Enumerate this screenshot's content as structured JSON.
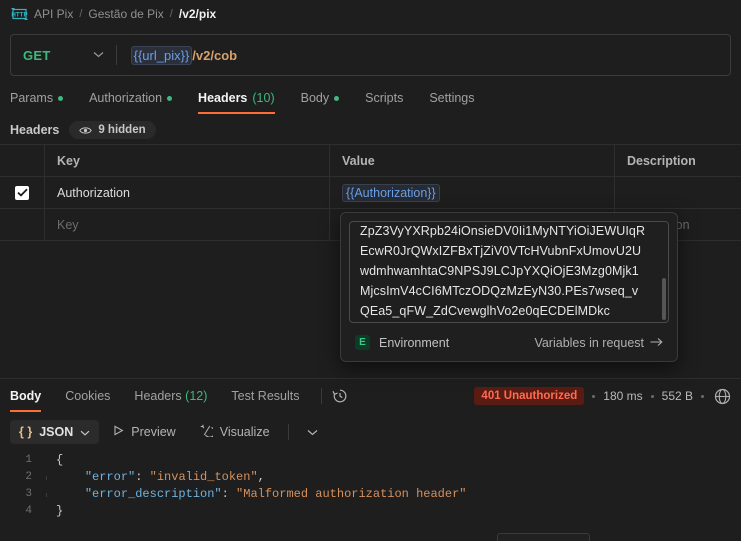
{
  "breadcrumb": {
    "icon": "http-protocol-icon",
    "items": [
      "API Pix",
      "Gestão de Pix"
    ],
    "separator": "/",
    "current": "/v2/pix"
  },
  "url_bar": {
    "method": "GET",
    "method_chevron": "chevron-down-icon",
    "url_variable": "{{url_pix}}",
    "url_path": "/v2/cob"
  },
  "request_tabs": [
    {
      "label": "Params",
      "dot": true,
      "count": "",
      "active": false
    },
    {
      "label": "Authorization",
      "dot": true,
      "count": "",
      "active": false
    },
    {
      "label": "Headers",
      "dot": false,
      "count": "(10)",
      "active": true
    },
    {
      "label": "Body",
      "dot": true,
      "count": "",
      "active": false
    },
    {
      "label": "Scripts",
      "dot": false,
      "count": "",
      "active": false
    },
    {
      "label": "Settings",
      "dot": false,
      "count": "",
      "active": false
    }
  ],
  "headers_section": {
    "title": "Headers",
    "hidden_badge": "9 hidden",
    "hidden_icon": "eye-icon",
    "columns": [
      "Key",
      "Value",
      "Description"
    ],
    "rows": [
      {
        "checked": true,
        "key": "Authorization",
        "value": "{{Authorization}}",
        "value_is_variable": true,
        "description": ""
      },
      {
        "checked": false,
        "key_placeholder": "Key",
        "value_placeholder": "Value",
        "description_placeholder": "Description"
      }
    ]
  },
  "variable_popup": {
    "token_value": "ZpZ3VyYXRpb24iOnsieDV0IjoiMyNTYiOiJEWUIqR EcwR0JrQWxIZFBxTjZiV0VTcHVubnFUUmovU2U wdmhwamhtaC9NPSJ9LCJpYXQiOjE3Mzg0Mjk1Mjcs ImV4cCI6MTczODQzMzEyN30.PEs7wseq_v QEa5_qFW_ZdCvewglhVo2e0qECDElMDkc",
    "token_lines": [
      "ZpZ3VyYXRpb24iOnsieDV0Ii1MyNTYiOiJEWUIqR",
      "EcwR0JrQWxIZFBxTjZiV0VTcHVubnFxUmovU2U",
      "wdmhwamhtaC9NPSJ9LCJpYXQiOjE3Mzg0Mjk1",
      "MjcsImV4cCI6MTczODQzMzEyN30.PEs7wseq_v",
      "QEa5_qFW_ZdCvewglhVo2e0qECDElMDkc"
    ],
    "environment_badge": "E",
    "environment_label": "Environment",
    "variables_link": "Variables in request",
    "variables_link_icon": "arrow-right-icon"
  },
  "response": {
    "tabs": [
      {
        "label": "Body",
        "count": "",
        "active": true
      },
      {
        "label": "Cookies",
        "count": "",
        "active": false
      },
      {
        "label": "Headers",
        "count": "(12)",
        "active": false
      },
      {
        "label": "Test Results",
        "count": "",
        "active": false
      }
    ],
    "history_icon": "clock-history-icon",
    "status": "401 Unauthorized",
    "time": "180 ms",
    "size": "552 B",
    "globe_icon": "globe-icon",
    "status_color": "#ff6b52",
    "status_bg": "#5a1c12"
  },
  "body_toolbar": {
    "format_label": "JSON",
    "format_icon": "braces-icon",
    "format_chevron": "chevron-down-icon",
    "preview_label": "Preview",
    "preview_icon": "play-triangle-icon",
    "visualize_label": "Visualize",
    "visualize_icon": "wand-icon",
    "more_chevron": "chevron-down-icon"
  },
  "response_body": {
    "lines": [
      {
        "num": "1",
        "indent": 0,
        "guide": false,
        "tokens": [
          {
            "t": "{",
            "c": "pun"
          }
        ]
      },
      {
        "num": "2",
        "indent": 1,
        "guide": true,
        "tokens": [
          {
            "t": "\"error\"",
            "c": "key"
          },
          {
            "t": ": ",
            "c": "pun"
          },
          {
            "t": "\"invalid_token\"",
            "c": "str"
          },
          {
            "t": ",",
            "c": "pun"
          }
        ]
      },
      {
        "num": "3",
        "indent": 1,
        "guide": true,
        "tokens": [
          {
            "t": "\"error_description\"",
            "c": "key"
          },
          {
            "t": ": ",
            "c": "pun"
          },
          {
            "t": "\"Malformed authorization header\"",
            "c": "str"
          }
        ]
      },
      {
        "num": "4",
        "indent": 0,
        "guide": false,
        "tokens": [
          {
            "t": "}",
            "c": "pun"
          }
        ]
      }
    ]
  },
  "theme": {
    "accent": "#ff6c37",
    "green": "#3db97c",
    "variable_blue": "#6b9fe8",
    "path_orange": "#d7a26a"
  }
}
